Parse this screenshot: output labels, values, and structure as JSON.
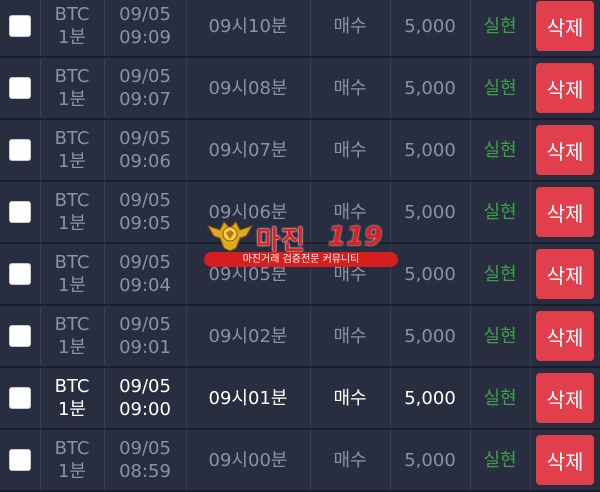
{
  "columns": {
    "symbol": "",
    "date": "",
    "time": "",
    "type": "",
    "amount": "",
    "status": "",
    "action": ""
  },
  "rows": [
    {
      "symbol": "BTC",
      "interval": "1분",
      "date": "09/05",
      "clock": "09:09",
      "round": "09시10분",
      "type": "매수",
      "amount": "5,000",
      "status": "실현",
      "action": "삭제",
      "active": false
    },
    {
      "symbol": "BTC",
      "interval": "1분",
      "date": "09/05",
      "clock": "09:07",
      "round": "09시08분",
      "type": "매수",
      "amount": "5,000",
      "status": "실현",
      "action": "삭제",
      "active": false
    },
    {
      "symbol": "BTC",
      "interval": "1분",
      "date": "09/05",
      "clock": "09:06",
      "round": "09시07분",
      "type": "매수",
      "amount": "5,000",
      "status": "실현",
      "action": "삭제",
      "active": false
    },
    {
      "symbol": "BTC",
      "interval": "1분",
      "date": "09/05",
      "clock": "09:05",
      "round": "09시06분",
      "type": "매수",
      "amount": "5,000",
      "status": "실현",
      "action": "삭제",
      "active": false
    },
    {
      "symbol": "BTC",
      "interval": "1분",
      "date": "09/05",
      "clock": "09:04",
      "round": "09시05분",
      "type": "매수",
      "amount": "5,000",
      "status": "실현",
      "action": "삭제",
      "active": false
    },
    {
      "symbol": "BTC",
      "interval": "1분",
      "date": "09/05",
      "clock": "09:01",
      "round": "09시02분",
      "type": "매수",
      "amount": "5,000",
      "status": "실현",
      "action": "삭제",
      "active": false
    },
    {
      "symbol": "BTC",
      "interval": "1분",
      "date": "09/05",
      "clock": "09:00",
      "round": "09시01분",
      "type": "매수",
      "amount": "5,000",
      "status": "실현",
      "action": "삭제",
      "active": true
    },
    {
      "symbol": "BTC",
      "interval": "1분",
      "date": "09/05",
      "clock": "08:59",
      "round": "09시00분",
      "type": "매수",
      "amount": "5,000",
      "status": "실현",
      "action": "삭제",
      "active": false
    }
  ],
  "watermark": {
    "brand": "마진",
    "brand_suffix": "119",
    "tagline": "마진거래 검증전문 커뮤니티"
  },
  "colors": {
    "background": "#262b3c",
    "status_green": "#3da14a",
    "delete_red": "#e23f4c",
    "text_muted": "#8c92a6",
    "text_active": "#ffffff"
  },
  "icons": {
    "watermark_emblem": "golden-eagle-emblem-icon"
  }
}
